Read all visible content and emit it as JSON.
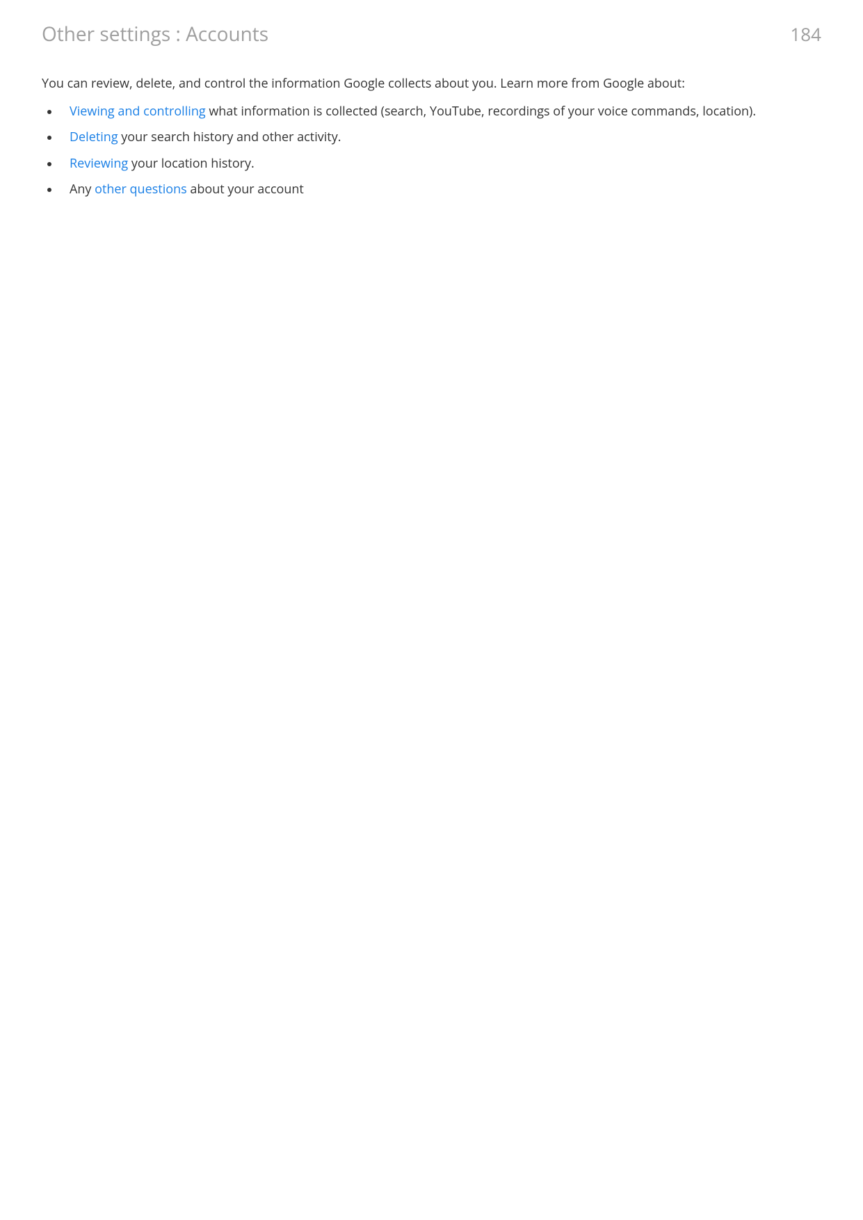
{
  "header": {
    "title": "Other settings : Accounts",
    "page_number": "184"
  },
  "intro": "You can review, delete, and control the information Google collects about you. Learn more from Google about:",
  "bullets": [
    {
      "link": "Viewing and controlling",
      "rest": " what information is collected (search, YouTube, recordings of your voice commands, location)."
    },
    {
      "link": "Deleting",
      "rest": " your search history and other activity."
    },
    {
      "link": "Reviewing",
      "rest": " your location history."
    },
    {
      "pre": "Any ",
      "link": "other questions",
      "rest": " about your account"
    }
  ]
}
